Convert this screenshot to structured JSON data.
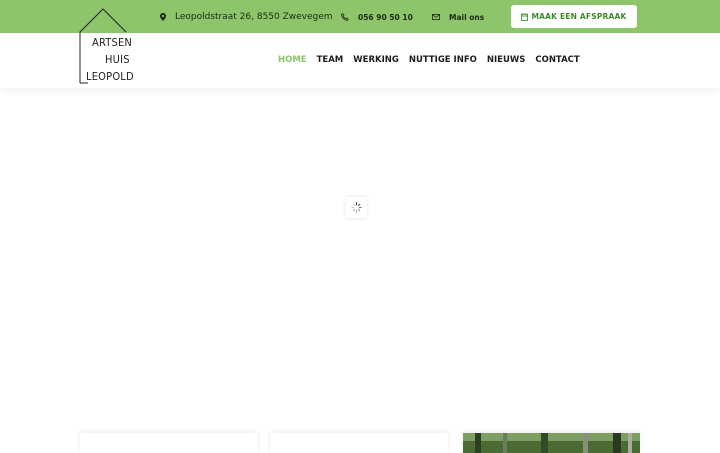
{
  "logo": {
    "line1": "ARTSEN",
    "line2": "HUIS",
    "line3": "LEOPOLD"
  },
  "topbar": {
    "address": "Leopoldstraat 26, 8550 Zwevegem",
    "address_icon": "map-pin-icon",
    "phone": "056 90 50 10",
    "phone_icon": "phone-icon",
    "mail": "Mail ons",
    "mail_icon": "envelope-icon",
    "cta_label": "MAAK EEN AFSPRAAK",
    "cta_icon": "calendar-icon"
  },
  "nav": {
    "items": [
      {
        "label": "HOME",
        "active": true
      },
      {
        "label": "TEAM",
        "active": false
      },
      {
        "label": "WERKING",
        "active": false
      },
      {
        "label": "NUTTIGE INFO",
        "active": false
      },
      {
        "label": "NIEUWS",
        "active": false
      },
      {
        "label": "CONTACT",
        "active": false
      }
    ]
  },
  "colors": {
    "brand_green": "#8cc56a",
    "cta_text": "#3f8a2a",
    "nav_text": "#1c1c1c"
  },
  "loader_icon": "spinner-icon"
}
